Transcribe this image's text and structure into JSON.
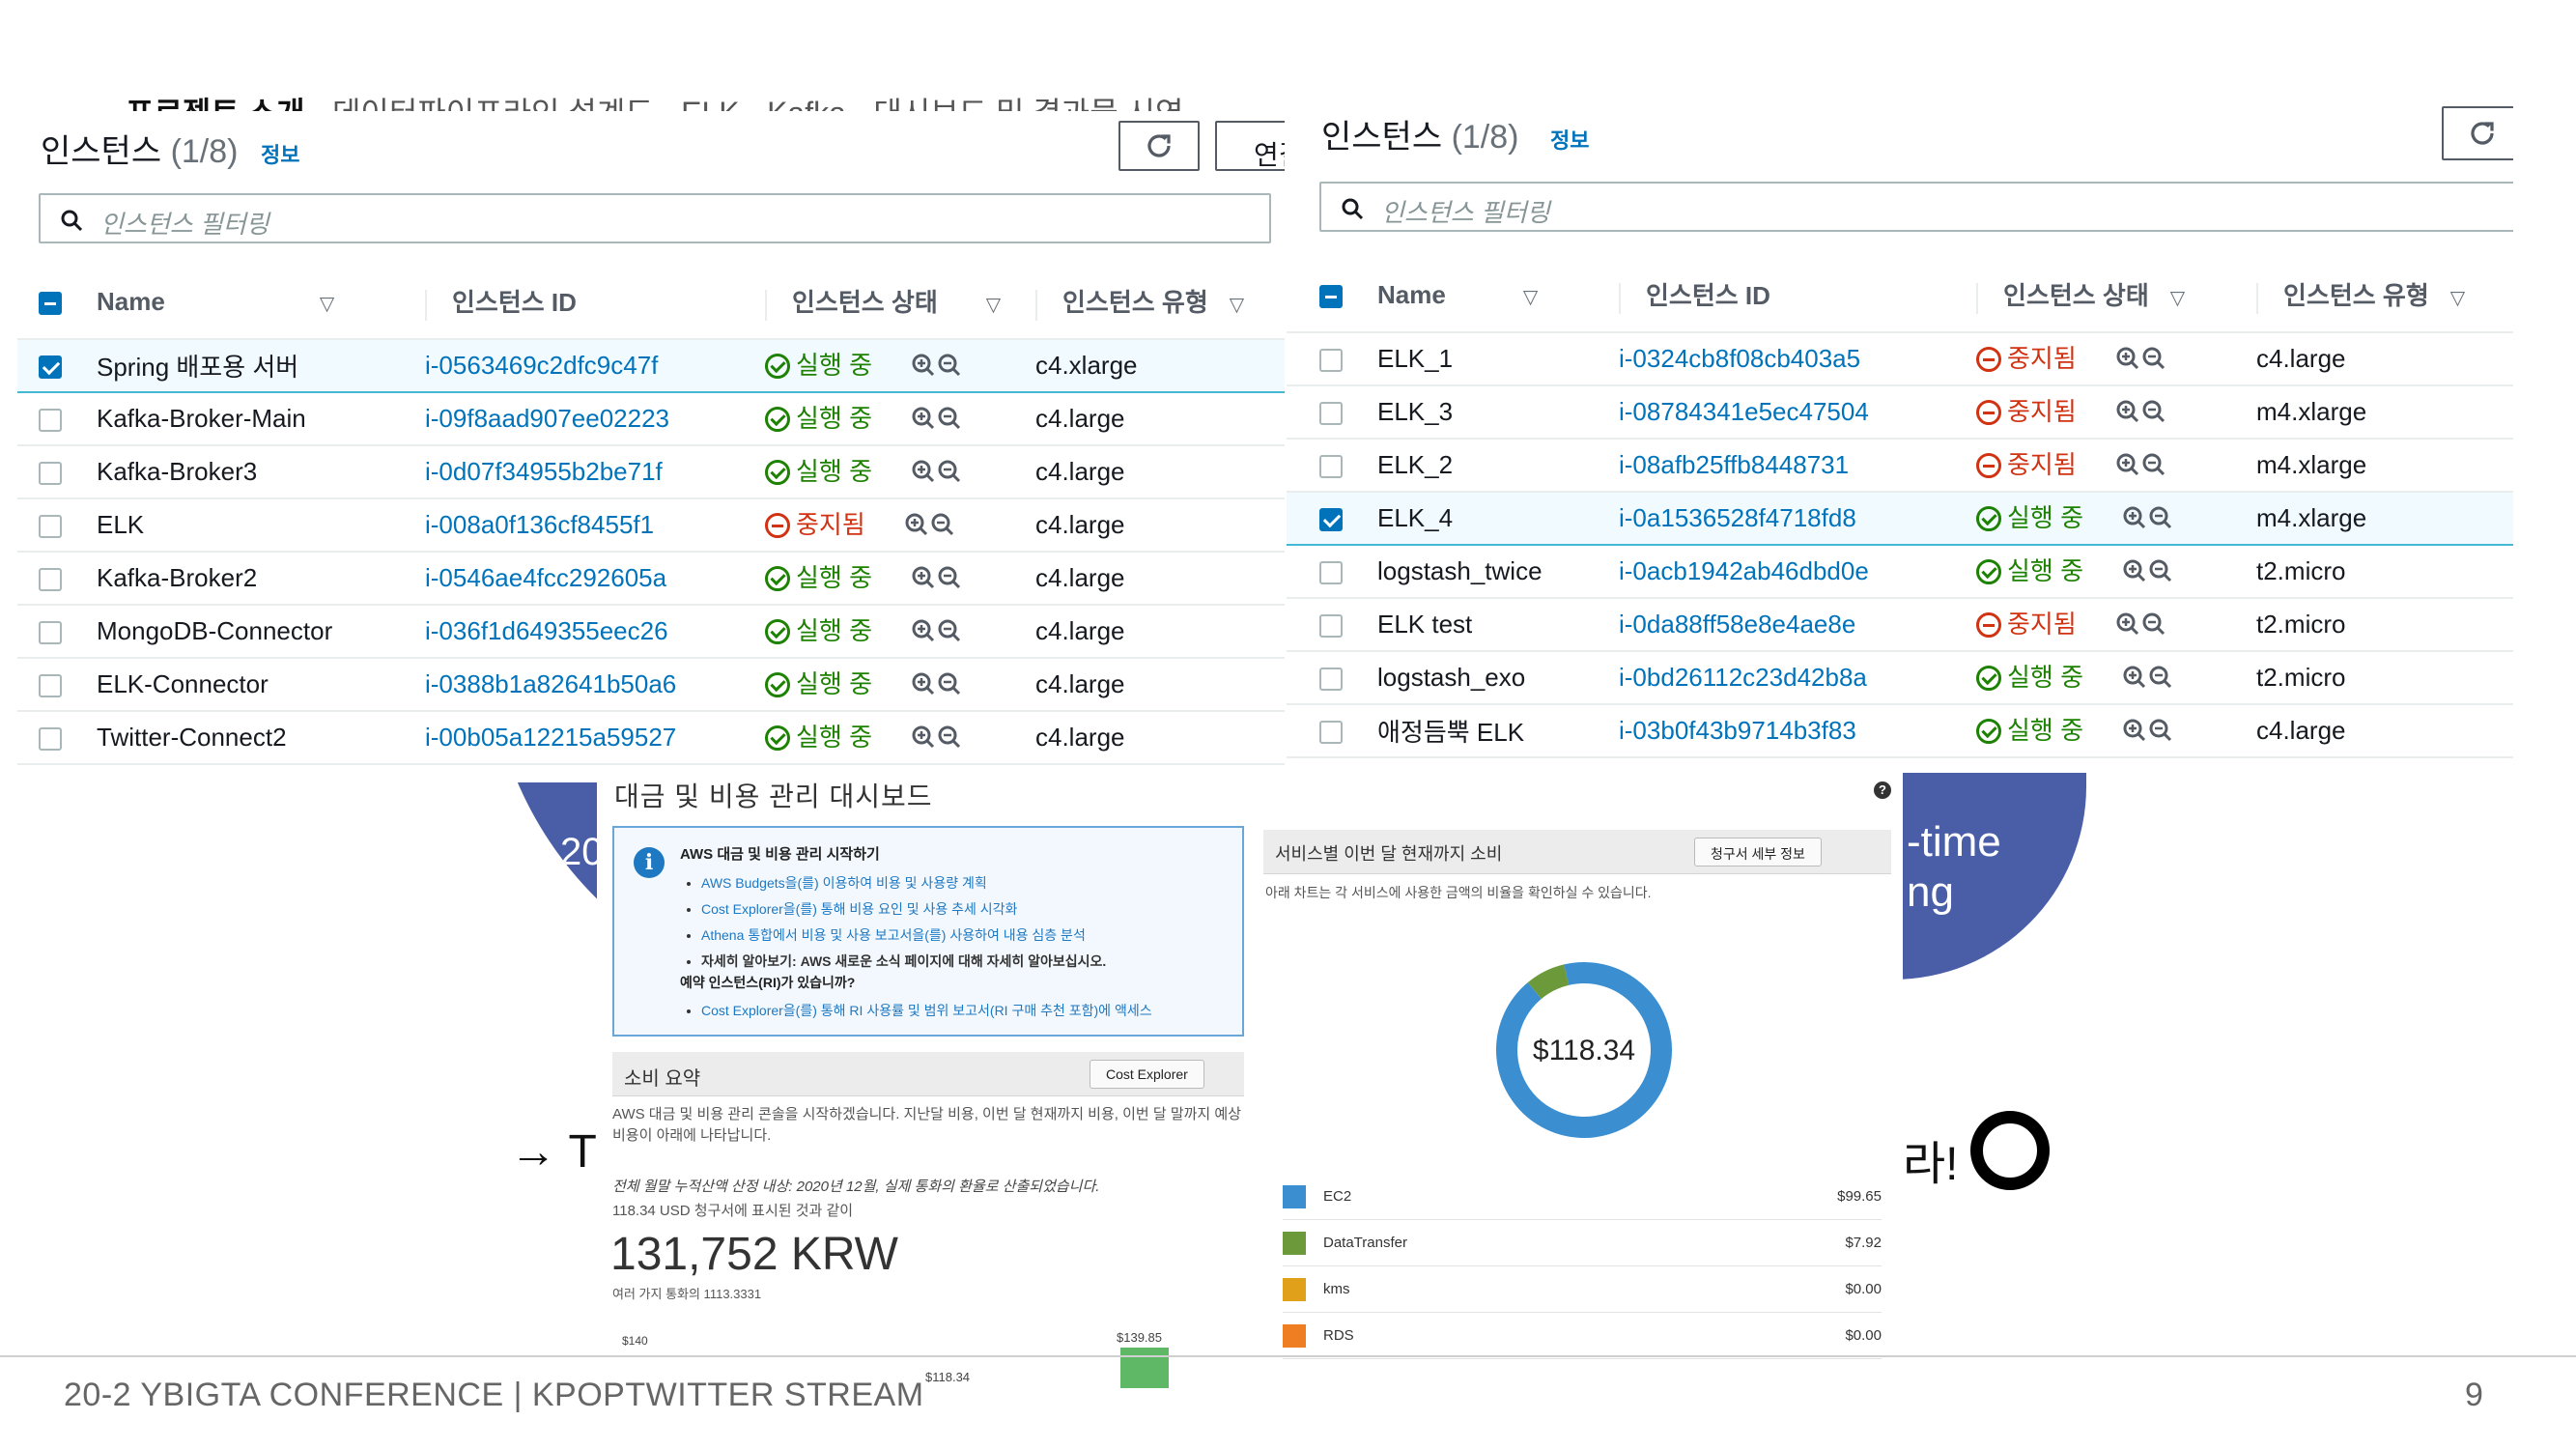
{
  "slide": {
    "nav": {
      "current": "프로젝트 소개",
      "items": [
        "데이터파이프라인 설계도",
        "ELK",
        "Kafka",
        "대시보드 및 결과물 시연"
      ]
    },
    "deco_left_text": "20",
    "deco_right_text": "-time\nng",
    "arrow_text": "→ T",
    "right_text": "라!",
    "footer": "20-2 YBIGTA CONFERENCE | KPOPTWITTER STREAM",
    "page_number": "9"
  },
  "left_panel": {
    "title": "인스턴스",
    "count": "(1/8)",
    "info": "정보",
    "connect_label": "연결",
    "filter_placeholder": "인스턴스 필터링",
    "columns": [
      "Name",
      "인스턴스 ID",
      "인스턴스 상태",
      "인스턴스 유형"
    ],
    "rows": [
      {
        "name": "Spring 배포용 서버",
        "id": "i-0563469c2dfc9c47f",
        "state": "실행 중",
        "running": true,
        "type": "c4.xlarge",
        "checked": true
      },
      {
        "name": "Kafka-Broker-Main",
        "id": "i-09f8aad907ee02223",
        "state": "실행 중",
        "running": true,
        "type": "c4.large",
        "checked": false
      },
      {
        "name": "Kafka-Broker3",
        "id": "i-0d07f34955b2be71f",
        "state": "실행 중",
        "running": true,
        "type": "c4.large",
        "checked": false
      },
      {
        "name": "ELK",
        "id": "i-008a0f136cf8455f1",
        "state": "중지됨",
        "running": false,
        "type": "c4.large",
        "checked": false
      },
      {
        "name": "Kafka-Broker2",
        "id": "i-0546ae4fcc292605a",
        "state": "실행 중",
        "running": true,
        "type": "c4.large",
        "checked": false
      },
      {
        "name": "MongoDB-Connector",
        "id": "i-036f1d649355eec26",
        "state": "실행 중",
        "running": true,
        "type": "c4.large",
        "checked": false
      },
      {
        "name": "ELK-Connector",
        "id": "i-0388b1a82641b50a6",
        "state": "실행 중",
        "running": true,
        "type": "c4.large",
        "checked": false
      },
      {
        "name": "Twitter-Connect2",
        "id": "i-00b05a12215a59527",
        "state": "실행 중",
        "running": true,
        "type": "c4.large",
        "checked": false
      }
    ]
  },
  "right_panel": {
    "title": "인스턴스",
    "count": "(1/8)",
    "info": "정보",
    "filter_placeholder": "인스턴스 필터링",
    "columns": [
      "Name",
      "인스턴스 ID",
      "인스턴스 상태",
      "인스턴스 유형"
    ],
    "rows": [
      {
        "name": "ELK_1",
        "id": "i-0324cb8f08cb403a5",
        "state": "중지됨",
        "running": false,
        "type": "c4.large",
        "checked": false
      },
      {
        "name": "ELK_3",
        "id": "i-08784341e5ec47504",
        "state": "중지됨",
        "running": false,
        "type": "m4.xlarge",
        "checked": false
      },
      {
        "name": "ELK_2",
        "id": "i-08afb25ffb8448731",
        "state": "중지됨",
        "running": false,
        "type": "m4.xlarge",
        "checked": false
      },
      {
        "name": "ELK_4",
        "id": "i-0a1536528f4718fd8",
        "state": "실행 중",
        "running": true,
        "type": "m4.xlarge",
        "checked": true
      },
      {
        "name": "logstash_twice",
        "id": "i-0acb1942ab46dbd0e",
        "state": "실행 중",
        "running": true,
        "type": "t2.micro",
        "checked": false
      },
      {
        "name": "ELK test",
        "id": "i-0da88ff58e8e4ae8e",
        "state": "중지됨",
        "running": false,
        "type": "t2.micro",
        "checked": false
      },
      {
        "name": "logstash_exo",
        "id": "i-0bd26112c23d42b8a",
        "state": "실행 중",
        "running": true,
        "type": "t2.micro",
        "checked": false
      },
      {
        "name": "애정듬뿍 ELK",
        "id": "i-03b0f43b9714b3f83",
        "state": "실행 중",
        "running": true,
        "type": "c4.large",
        "checked": false
      }
    ]
  },
  "billing": {
    "title": "대금 및 비용 관리 대시보드",
    "help": "?",
    "info_heading": "AWS 대금 및 비용 관리 시작하기",
    "info_items": [
      "AWS Budgets을(를) 이용하여 비용 및 사용량 계획",
      "Cost Explorer을(를) 통해 비용 요인 및 사용 추세 시각화",
      "Athena 통합에서 비용 및 사용 보고서을(를) 사용하여 내용 심층 분석",
      "자세히 알아보기: AWS 새로운 소식 페이지에 대해 자세히 알아보십시오."
    ],
    "ri_heading": "예약 인스턴스(RI)가 있습니까?",
    "ri_item": "Cost Explorer을(를) 통해 RI 사용률 및 범위 보고서(RI 구매 추천 포함)에 액세스",
    "summary_title": "소비 요약",
    "summary_btn": "Cost Explorer",
    "summary_desc": "AWS 대금 및 비용 관리 콘솔을 시작하겠습니다. 지난달 비용, 이번 달 현재까지 비용, 이번 달 말까지 예상 비용이 아래에 나타납니다.",
    "forecast_note": "전체 월말 누적산액 산정 내상: 2020년 12월, 실제 통화의 환율로 산출되었습니다.",
    "usd_note": "118.34 USD 청구서에 표시된 것과 같이",
    "big_amount": "131,752 KRW",
    "rate_note": "여러 가지 통화의 1113.3331",
    "bar_axis_label": "$140",
    "bar_value_label": "$139.85",
    "bar_left_label": "$118.34",
    "service_title": "서비스별 이번 달 현재까지 소비",
    "service_btn": "청구서 세부 정보",
    "service_desc": "아래 차트는 각 서비스에 사용한 금액의 비율을 확인하실 수 있습니다.",
    "donut_total": "$118.34",
    "services": [
      {
        "name": "EC2",
        "amount": "$99.65",
        "value": 99.65,
        "color": "#3b8fd1"
      },
      {
        "name": "DataTransfer",
        "amount": "$7.92",
        "value": 7.92,
        "color": "#6c9a3a"
      },
      {
        "name": "kms",
        "amount": "$0.00",
        "value": 0.0,
        "color": "#e0a01a"
      },
      {
        "name": "RDS",
        "amount": "$0.00",
        "value": 0.0,
        "color": "#ef7d22"
      }
    ]
  }
}
